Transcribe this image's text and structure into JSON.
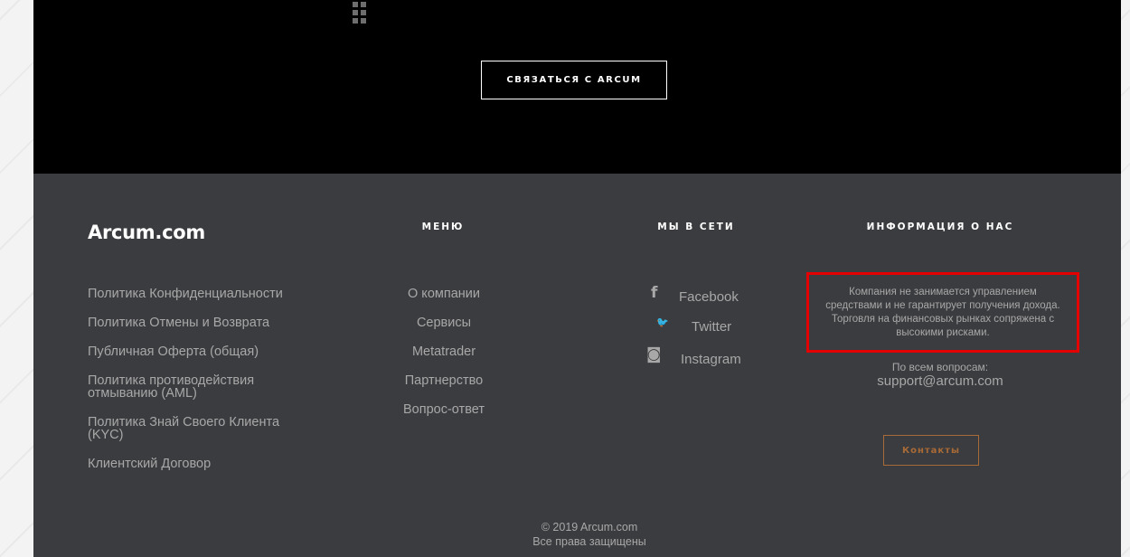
{
  "hero": {
    "cta_label": "СВЯЗАТЬСЯ С ARCUM"
  },
  "footer": {
    "logo": "Arcum.com",
    "menu_title": "МЕНЮ",
    "social_title": "МЫ В СЕТИ",
    "info_title": "ИНФОРМАЦИЯ О НАС",
    "policies": [
      "Политика Конфиденциальности",
      "Политика Отмены и Возврата",
      "Публичная Оферта (общая)",
      "Политика противодействия отмыванию (AML)",
      "Политика Знай Своего Клиента (KYC)",
      "Клиентский Договор"
    ],
    "menu": [
      "О компании",
      "Сервисы",
      "Metatrader",
      "Партнерство",
      "Вопрос-ответ"
    ],
    "social": [
      {
        "icon": "facebook-icon",
        "glyph": "f",
        "label": "Facebook"
      },
      {
        "icon": "twitter-icon",
        "glyph": "🐦",
        "label": "Twitter"
      },
      {
        "icon": "instagram-icon",
        "glyph": "◙",
        "label": "Instagram"
      }
    ],
    "disclaimer": "Компания не занимается управлением средствами и не гарантирует получения дохода. Торговля на финансовых рынках сопряжена с высокими рисками.",
    "questions_label": "По всем вопросам:",
    "email": "support@arcum.com",
    "contacts_button": "Контакты",
    "copyright_line1": "© 2019 Arcum.com",
    "copyright_line2": "Все права защищены"
  },
  "colors": {
    "hero_bg": "#000000",
    "footer_bg": "#3b3c3f",
    "footer_text": "#a8a8a8",
    "highlight_border": "#e40000",
    "accent_button": "#a86a36"
  }
}
